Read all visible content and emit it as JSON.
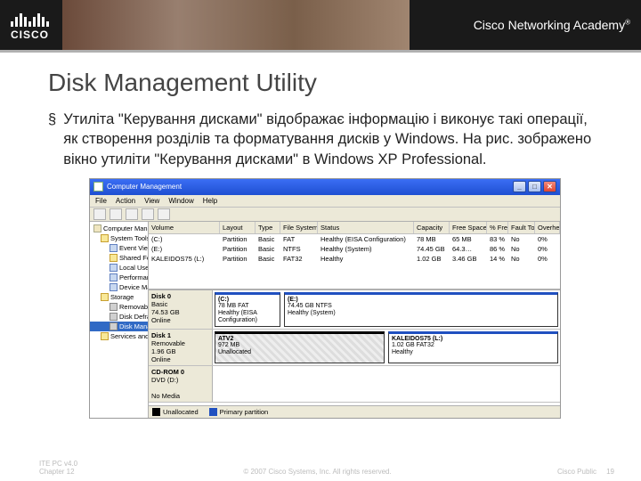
{
  "banner": {
    "brand": "CISCO",
    "academy": "Cisco Networking Academy"
  },
  "slide": {
    "title": "Disk Management Utility",
    "bullet": "Утиліта \"Керування дисками\" відображає інформацію і виконує такі операції, як створення розділів та форматування дисків у Windows. На рис. зображено вікно утиліти \"Керування дисками\" в Windows ХР Professional."
  },
  "win": {
    "title": "Computer Management",
    "menu": {
      "file": "File",
      "action": "Action",
      "view": "View",
      "window": "Window",
      "help": "Help"
    },
    "btn": {
      "min": "_",
      "max": "□",
      "close": "✕"
    }
  },
  "tree": {
    "root": "Computer Management (Loc",
    "systools": "System Tools",
    "eventviewer": "Event Viewer",
    "sharedfolders": "Shared Folders",
    "localusers": "Local Users and Groups",
    "perflogs": "Performance Logs and",
    "devmgr": "Device Manager",
    "storage": "Storage",
    "removable": "Removable Storage",
    "defrag": "Disk Defragmenter",
    "diskmgmt": "Disk Management",
    "services": "Services and Applications"
  },
  "volhead": {
    "vol": "Volume",
    "layout": "Layout",
    "type": "Type",
    "fs": "File System",
    "status": "Status",
    "cap": "Capacity",
    "free": "Free Space",
    "pct": "% Free",
    "ft": "Fault Tole",
    "ov": "Overhead"
  },
  "vols": [
    {
      "vol": "(C:)",
      "layout": "Partition",
      "type": "Basic",
      "fs": "FAT",
      "status": "Healthy (EISA Configuration)",
      "cap": "78 MB",
      "free": "65 MB",
      "pct": "83 %",
      "ft": "No",
      "ov": "0%"
    },
    {
      "vol": "(E:)",
      "layout": "Partition",
      "type": "Basic",
      "fs": "NTFS",
      "status": "Healthy (System)",
      "cap": "74.45 GB",
      "free": "64.3…",
      "pct": "86 %",
      "ft": "No",
      "ov": "0%"
    },
    {
      "vol": "KALEIDOS75 (L:)",
      "layout": "Partition",
      "type": "Basic",
      "fs": "FAT32",
      "status": "Healthy",
      "cap": "1.02 GB",
      "free": "3.46 GB",
      "pct": "14 %",
      "ft": "No",
      "ov": "0%"
    }
  ],
  "disks": {
    "d0": {
      "name": "Disk 0",
      "kind": "Basic",
      "size": "74.53 GB",
      "state": "Online",
      "p1_name": "(C:)",
      "p1_l1": "78 MB FAT",
      "p1_l2": "Healthy (EISA Configuration)",
      "p2_name": "(E:)",
      "p2_l1": "74.45 GB NTFS",
      "p2_l2": "Healthy (System)"
    },
    "d1": {
      "name": "Disk 1",
      "kind": "Removable",
      "size": "1.96 GB",
      "state": "Online",
      "p1_name": "ATV2",
      "p1_l1": "972 MB",
      "p1_l2": "Unallocated",
      "p2_name": "KALEIDOS75 (L:)",
      "p2_l1": "1.02 GB FAT32",
      "p2_l2": "Healthy"
    },
    "cd": {
      "name": "CD-ROM 0",
      "kind": "DVD (D:)",
      "nomedia": "No Media"
    }
  },
  "legend": {
    "una": "Unallocated",
    "pri": "Primary partition"
  },
  "footer": {
    "left1": "ITE PC v4.0",
    "left2": "Chapter 12",
    "center": "© 2007 Cisco Systems, Inc. All rights reserved.",
    "public": "Cisco Public",
    "page": "19"
  }
}
